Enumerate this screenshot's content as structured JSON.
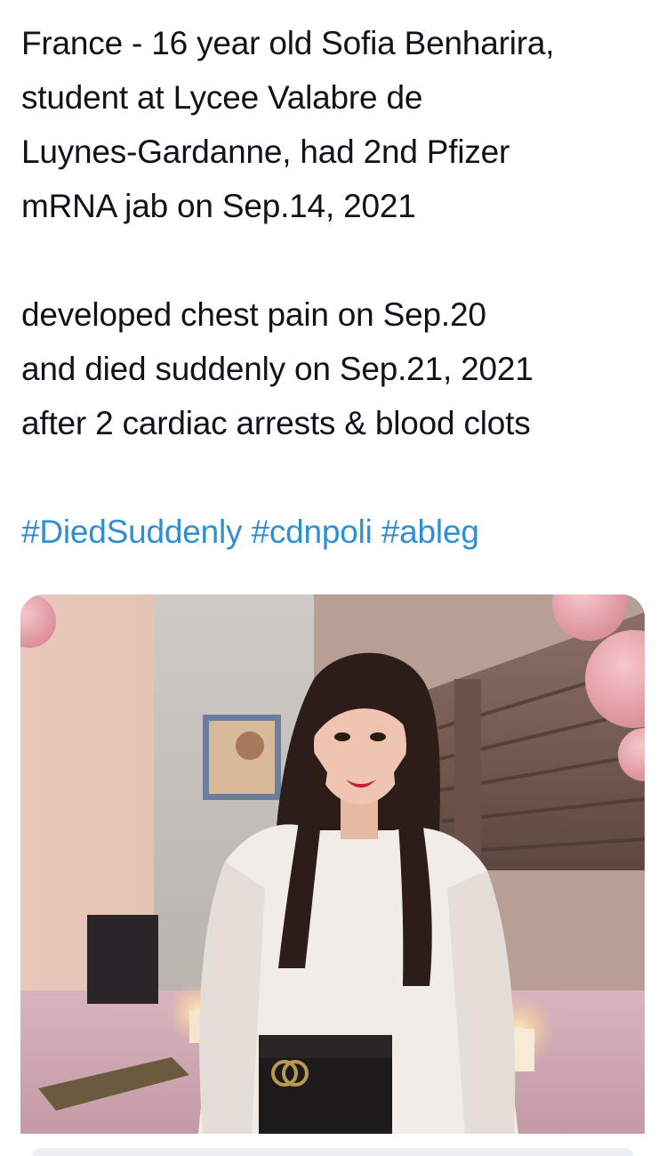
{
  "tweet": {
    "lines_p1": [
      "France - 16 year old Sofia Benharira,",
      "student at Lycee Valabre de",
      "Luynes-Gardanne, had 2nd Pfizer",
      "mRNA jab on Sep.14, 2021"
    ],
    "lines_p2": [
      "developed chest pain on Sep.20",
      "and died suddenly on Sep.21, 2021",
      "after 2 cardiac arrests & blood clots"
    ],
    "hashtags": [
      "#DiedSuddenly",
      "#cdnpoli",
      "#ableg"
    ]
  },
  "colors": {
    "text": "#0f1419",
    "hashtag": "#2f8fd6",
    "background": "#ffffff"
  },
  "media": {
    "kind": "photo",
    "icon": "photo-icon"
  }
}
